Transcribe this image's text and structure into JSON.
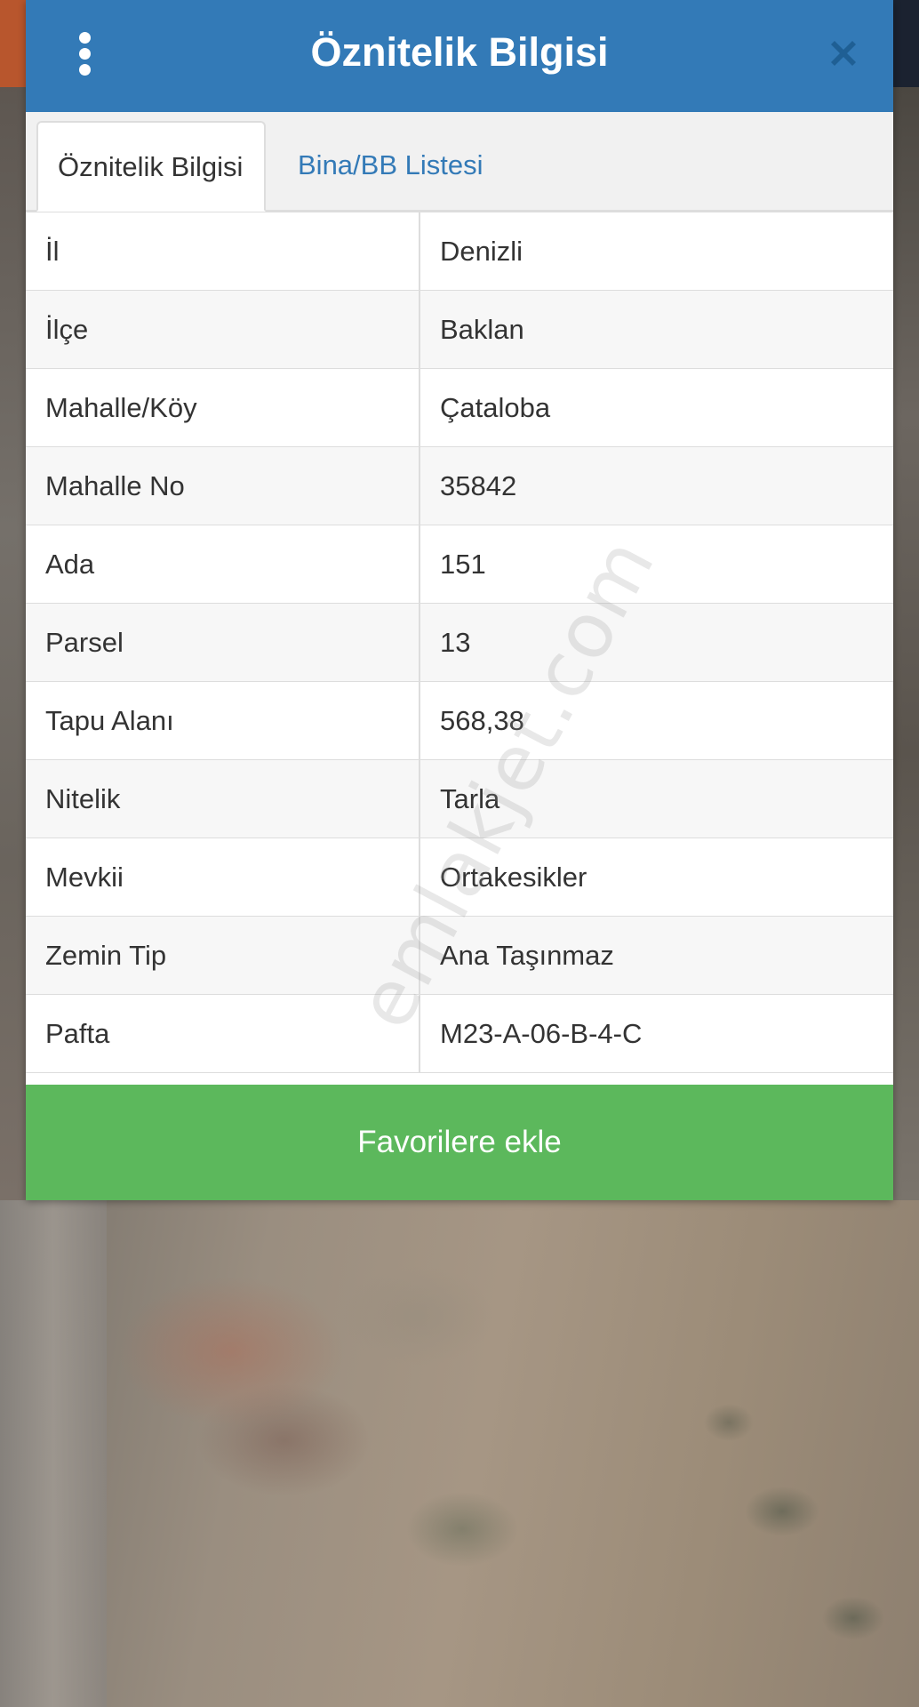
{
  "header": {
    "title": "Öznitelik Bilgisi",
    "menu_icon": "vertical-dots-icon",
    "close_icon": "close-icon",
    "background_color": "#337ab7"
  },
  "tabs": [
    {
      "label": "Öznitelik Bilgisi",
      "active": true
    },
    {
      "label": "Bina/BB Listesi",
      "active": false
    }
  ],
  "attributes": [
    {
      "label": "İl",
      "value": "Denizli"
    },
    {
      "label": "İlçe",
      "value": "Baklan"
    },
    {
      "label": "Mahalle/Köy",
      "value": "Çataloba"
    },
    {
      "label": "Mahalle No",
      "value": "35842"
    },
    {
      "label": "Ada",
      "value": "151"
    },
    {
      "label": "Parsel",
      "value": "13"
    },
    {
      "label": "Tapu Alanı",
      "value": "568,38"
    },
    {
      "label": "Nitelik",
      "value": "Tarla"
    },
    {
      "label": "Mevkii",
      "value": "Ortakesikler"
    },
    {
      "label": "Zemin Tip",
      "value": "Ana Taşınmaz"
    },
    {
      "label": "Pafta",
      "value": "M23-A-06-B-4-C"
    }
  ],
  "favorite_button": {
    "label": "Favorilere ekle",
    "color": "#5cb85c"
  },
  "watermark": "emlakjet.com"
}
